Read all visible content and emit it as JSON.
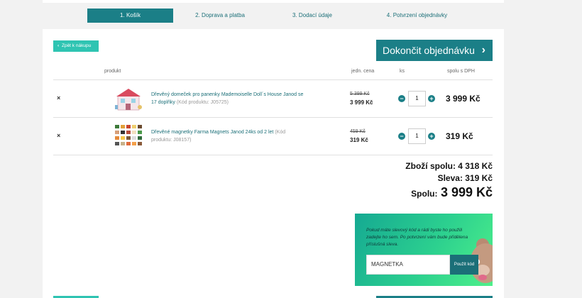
{
  "steps": [
    {
      "label": "1. Košík",
      "active": true
    },
    {
      "label": "2. Doprava a platba",
      "active": false
    },
    {
      "label": "3. Dodací údaje",
      "active": false
    },
    {
      "label": "4. Potvrzení objednávky",
      "active": false
    }
  ],
  "back_button": {
    "label": "Zpět k nákupu"
  },
  "finish_button": {
    "label": "Dokončit objednávku"
  },
  "table": {
    "headers": {
      "product": "produkt",
      "unit_price": "jedn. cena",
      "qty": "ks",
      "total": "spolu s DPH"
    },
    "rows": [
      {
        "name": "Dřevěný domeček pro panenky Mademoiselle Doll´s House Janod se 17 doplňky",
        "code": "(Kód produktu: J05725)",
        "old_price": "5 399 Kč",
        "price": "3 999 Kč",
        "qty": "1",
        "total": "3 999 Kč"
      },
      {
        "name": "Dřevěné magnetky Farma Magnets Janod 24ks od 2 let",
        "code": "(Kód produktu: J08157)",
        "old_price": "459 Kč",
        "price": "319 Kč",
        "qty": "1",
        "total": "319 Kč"
      }
    ]
  },
  "summary": {
    "goods_label": "Zboží spolu:",
    "goods_value": "4 318 Kč",
    "discount_label": "Sleva:",
    "discount_value": "319 Kč",
    "total_label": "Spolu:",
    "total_value": "3 999 Kč"
  },
  "discount": {
    "text": "Pokud máte slevový kód a rádi byste ho použili zadejte ho sem. Po potvrzení vám bude přidělena příslušná sleva.",
    "input_value": "MAGNETKA",
    "apply_label": "Použít kód"
  },
  "icons": {
    "remove": "×",
    "minus": "−",
    "plus": "+",
    "back_chevron": "‹",
    "finish_arrow": "›"
  },
  "colors": {
    "accent": "#1b7f87",
    "teal_light": "#2fc4b2",
    "link": "#1b6f78"
  }
}
